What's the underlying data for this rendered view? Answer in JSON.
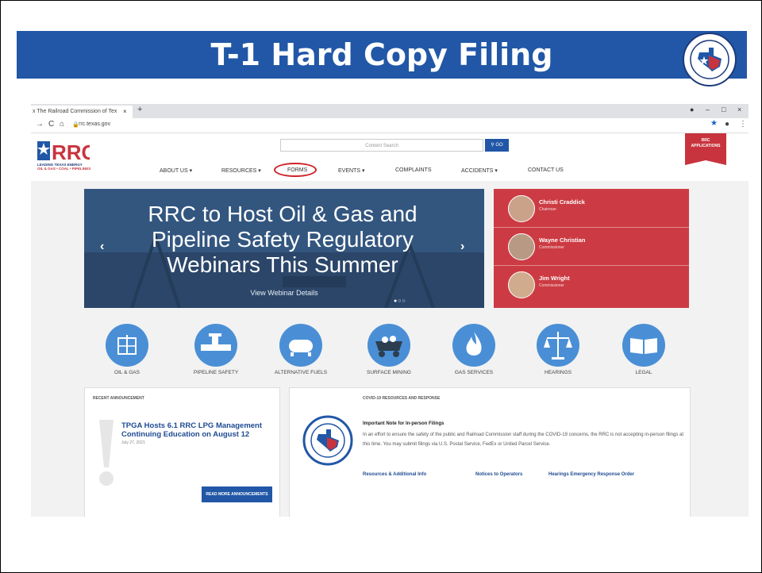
{
  "slide": {
    "title": "T-1 Hard Copy Filing",
    "seal_text": "RAILROAD COMMISSION OF TEXAS"
  },
  "browser": {
    "tab_title": "x The Railroad Commission of Tex",
    "tab_close": "×",
    "new_tab": "+",
    "url": "rrc.texas.gov",
    "colors": {
      "tabbar": "#dfe1e5"
    }
  },
  "site": {
    "logo_text": "RRC",
    "logo_tagline": "LEADING TEXAS ENERGY",
    "logo_subline": "OIL & GAS • COAL • PIPELINES",
    "search_placeholder": "Content Search",
    "go_label": "GO",
    "apps_line1": "RRC",
    "apps_line2": "APPLICATIONS",
    "menu": {
      "about": "ABOUT US",
      "resources": "RESOURCES",
      "forms": "FORMS",
      "events": "EVENTS",
      "complaints": "COMPLAINTS",
      "accidents": "ACCIDENTS",
      "contact": "CONTACT US"
    },
    "hero": {
      "line1": "RRC to Host Oil & Gas and",
      "line2": "Pipeline Safety Regulatory",
      "line3": "Webinars This Summer",
      "link": "View Webinar Details"
    },
    "commissioners": [
      {
        "name": "Christi Craddick",
        "role": "Chairman"
      },
      {
        "name": "Wayne Christian",
        "role": "Commissioner"
      },
      {
        "name": "Jim Wright",
        "role": "Commissioner"
      }
    ],
    "categories": [
      {
        "label": "OIL & GAS",
        "icon": "oil-derrick-icon"
      },
      {
        "label": "PIPELINE SAFETY",
        "icon": "pipeline-icon"
      },
      {
        "label": "ALTERNATIVE FUELS",
        "icon": "fuel-tank-icon"
      },
      {
        "label": "SURFACE MINING",
        "icon": "mining-cart-icon"
      },
      {
        "label": "GAS SERVICES",
        "icon": "gas-flame-icon"
      },
      {
        "label": "HEARINGS",
        "icon": "scales-icon"
      },
      {
        "label": "LEGAL",
        "icon": "open-book-icon"
      }
    ],
    "announcement": {
      "header": "RECENT ANNOUNCEMENT",
      "title": "TPGA Hosts 6.1 RRC LPG Management Continuing Education on August 12",
      "date": "July 27, 2021",
      "button": "READ MORE ANNOUNCEMENTS"
    },
    "covid": {
      "header": "COVID-19 RESOURCES AND RESPONSE",
      "important": "Important Note for In-person Filings",
      "body": "In an effort to ensure the safety of the public and Railroad Commission staff during the COVID-19 concerns, the RRC is not accepting in-person filings at this time. You may submit filings via U.S. Postal Service, FedEx or United Parcel Service.",
      "link1": "Resources & Additional Info",
      "link2": "Notices to Operators",
      "link3": "Hearings Emergency Response Order"
    },
    "colors": {
      "brand_blue": "#2157a6",
      "hero": "#33567f",
      "commissioner_panel": "#cc3b43",
      "icon_circle": "#4a8fd6",
      "forms_highlight": "#d0232b"
    }
  }
}
